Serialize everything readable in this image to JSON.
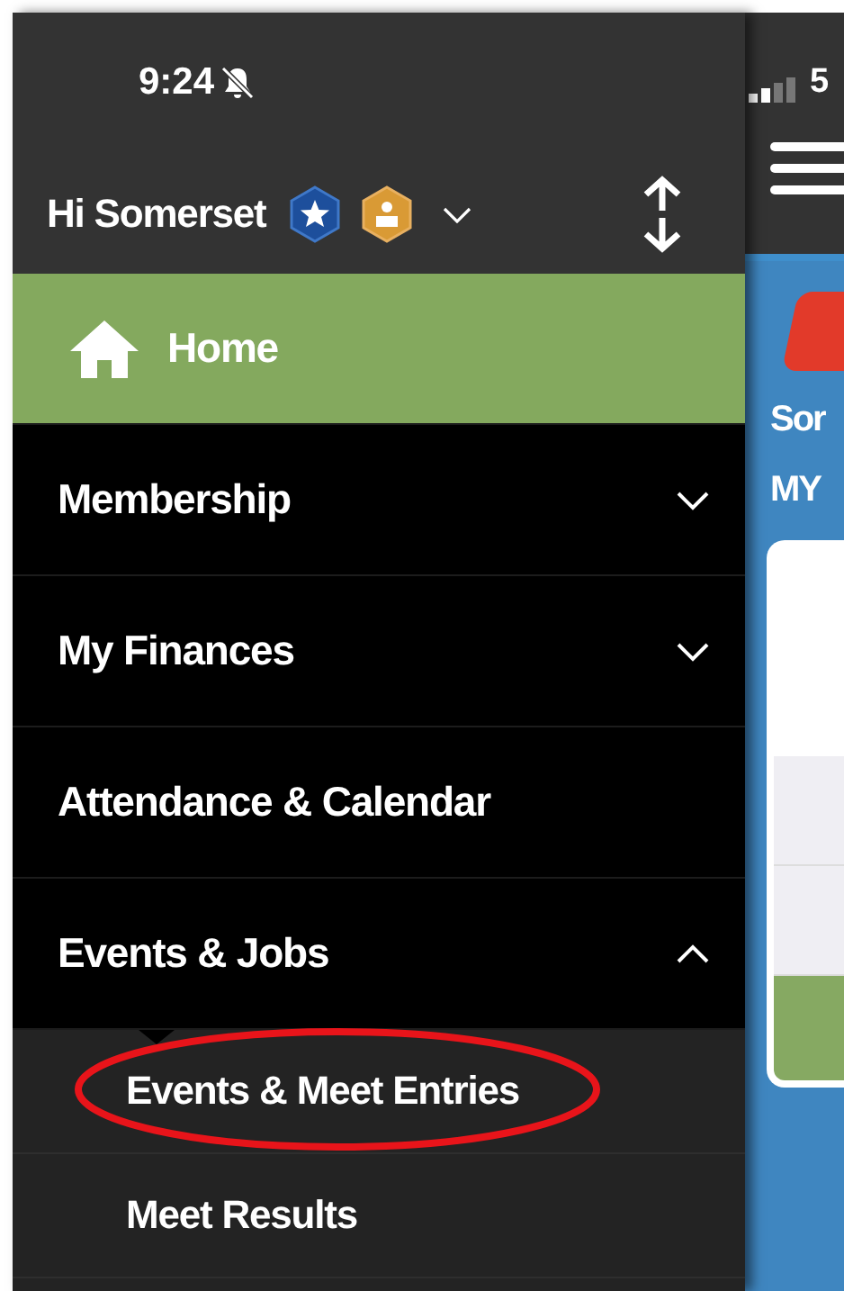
{
  "status_bar": {
    "time": "9:24",
    "silent": true
  },
  "header": {
    "greeting": "Hi Somerset",
    "expanded": false
  },
  "menu": [
    {
      "kind": "home",
      "label": "Home",
      "selected": true
    },
    {
      "kind": "section",
      "label": "Membership",
      "expanded": false,
      "selected": false
    },
    {
      "kind": "section",
      "label": "My Finances",
      "expanded": false,
      "selected": false
    },
    {
      "kind": "link",
      "label": "Attendance & Calendar",
      "selected": false
    },
    {
      "kind": "section",
      "label": "Events & Jobs",
      "expanded": true,
      "selected": false,
      "children": [
        {
          "label": "Events & Meet Entries",
          "circled": true
        },
        {
          "label": "Meet Results",
          "circled": false
        }
      ]
    }
  ],
  "background_page": {
    "carrier": "5",
    "title": "Sor",
    "heading": "MY"
  }
}
